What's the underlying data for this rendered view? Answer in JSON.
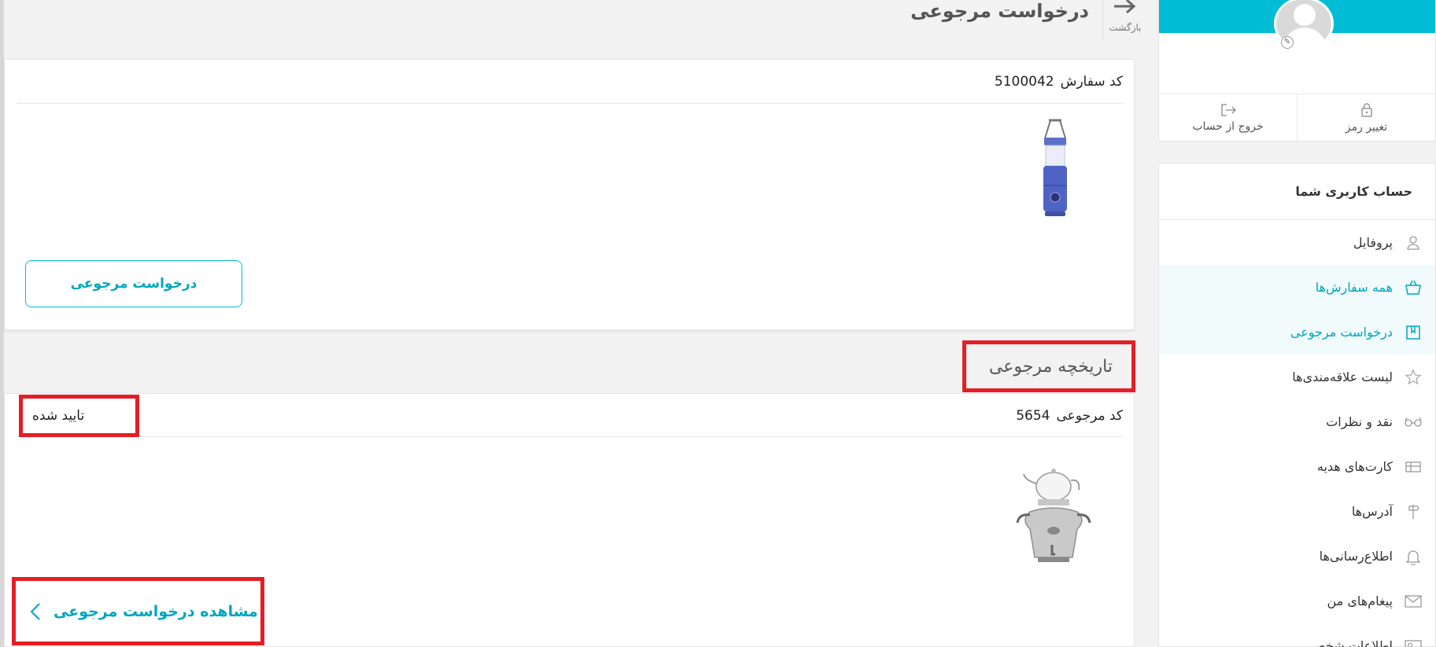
{
  "sidebar": {
    "profile": {
      "change_password": "تغییر رمز",
      "logout": "خروج از حساب"
    },
    "menu_title": "حساب کاربری شما",
    "items": [
      {
        "label": "پروفایل",
        "icon": "user-icon"
      },
      {
        "label": "همه سفارش‌ها",
        "icon": "basket-icon",
        "active": true
      },
      {
        "label": "درخواست مرجوعی",
        "icon": "return-box-icon",
        "active": true
      },
      {
        "label": "لیست علاقه‌مندی‌ها",
        "icon": "star-icon"
      },
      {
        "label": "نقد و نظرات",
        "icon": "glasses-icon"
      },
      {
        "label": "کارت‌های هدیه",
        "icon": "gift-card-icon"
      },
      {
        "label": "آدرس‌ها",
        "icon": "signpost-icon"
      },
      {
        "label": "اطلاع‌رسانی‌ها",
        "icon": "bell-icon"
      },
      {
        "label": "پیغام‌های من",
        "icon": "envelope-icon"
      },
      {
        "label": "اطلاعات شخصی",
        "icon": "id-card-icon"
      }
    ]
  },
  "header": {
    "back_label": "بازگشت",
    "title": "درخواست مرجوعی"
  },
  "order": {
    "code_label": "کد سفارش",
    "code_value": "5100042",
    "product_image": "camping-lantern",
    "return_button": "درخواست مرجوعی"
  },
  "history": {
    "title": "تاریخچه مرجوعی",
    "code_label": "کد مرجوعی",
    "code_value": "5654",
    "status": "تایید شده",
    "product_image": "samovar-teapot",
    "view_link": "مشاهده درخواست مرجوعی"
  },
  "colors": {
    "accent": "#00bcd4",
    "accent_text": "#00a5bd",
    "highlight_border": "#e41e26"
  }
}
